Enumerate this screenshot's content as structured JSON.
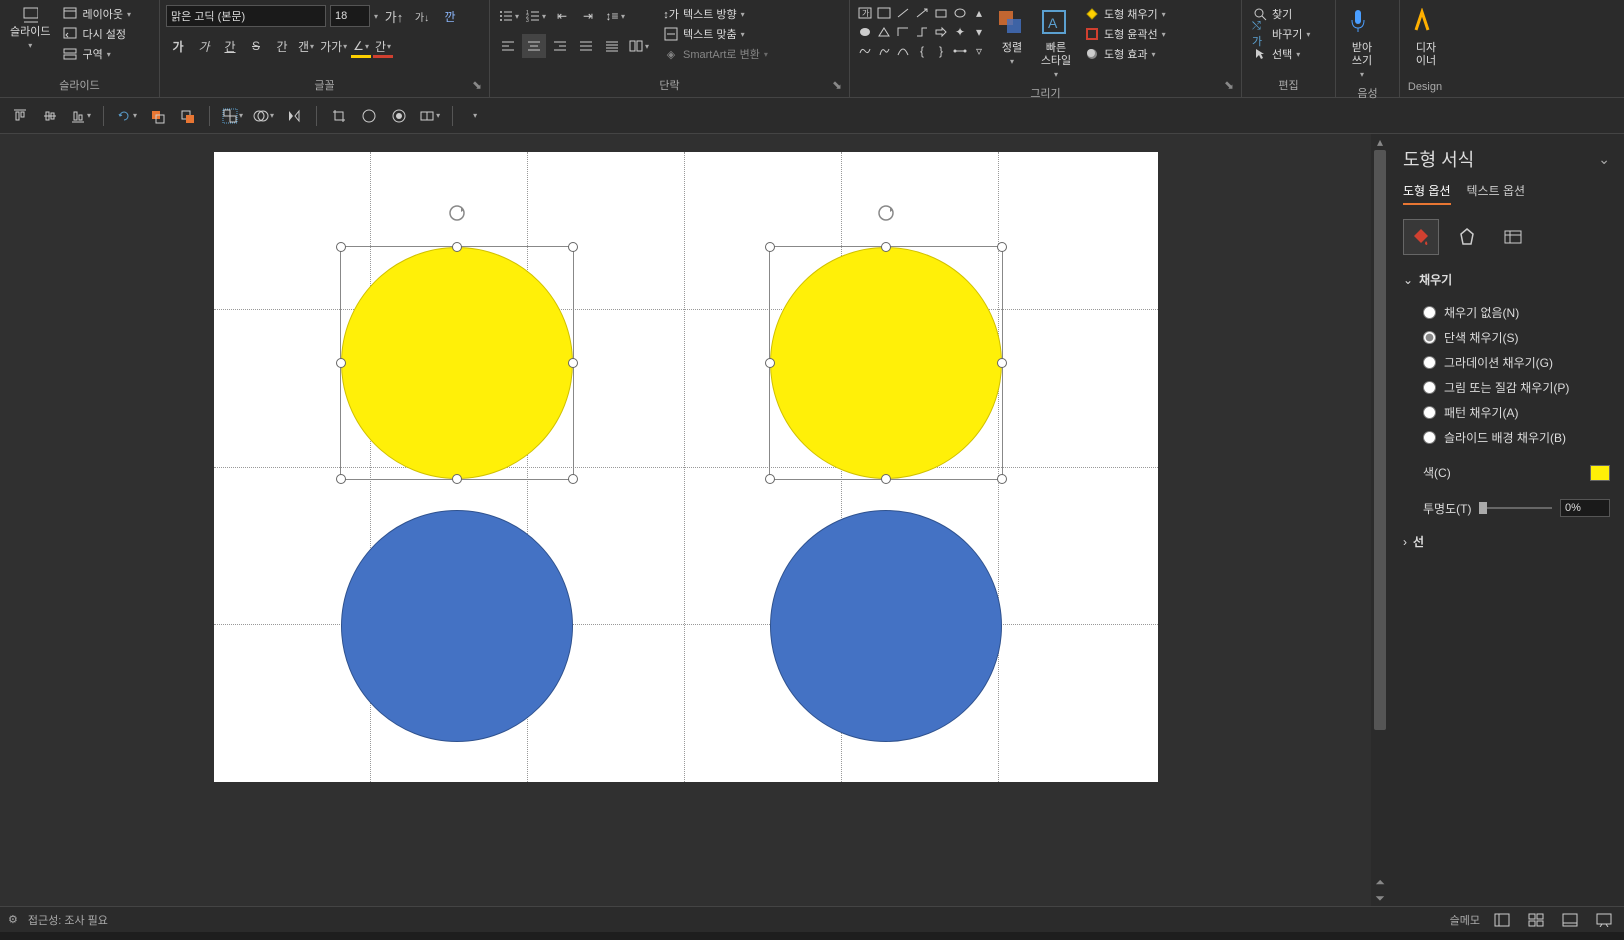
{
  "ribbon": {
    "slide_group": {
      "new_slide": "슬라이드",
      "layout": "레이아웃",
      "reset": "다시 설정",
      "section": "구역",
      "label": "슬라이드"
    },
    "font_group": {
      "font_name": "맑은 고딕 (본문)",
      "font_size": "18",
      "label": "글꼴"
    },
    "paragraph_group": {
      "text_direction": "텍스트 방향",
      "align_text": "텍스트 맞춤",
      "smartart": "SmartArt로 변환",
      "label": "단락"
    },
    "drawing_group": {
      "arrange": "정렬",
      "quick_styles": "빠른\n스타일",
      "shape_fill": "도형 채우기",
      "shape_outline": "도형 윤곽선",
      "shape_effects": "도형 효과",
      "label": "그리기"
    },
    "editing_group": {
      "find": "찾기",
      "replace": "바꾸기",
      "select": "선택",
      "label": "편집"
    },
    "voice_group": {
      "dictate": "받아\n쓰기",
      "label": "음성"
    },
    "design_group": {
      "designer": "디자\n이너",
      "label": "Design"
    }
  },
  "format_pane": {
    "title": "도형 서식",
    "tab_shape": "도형 옵션",
    "tab_text": "텍스트 옵션",
    "section_fill": "채우기",
    "fill_none": "채우기 없음(N)",
    "fill_solid": "단색 채우기(S)",
    "fill_gradient": "그라데이션 채우기(G)",
    "fill_picture": "그림 또는 질감 채우기(P)",
    "fill_pattern": "패턴 채우기(A)",
    "fill_slidebg": "슬라이드 배경 채우기(B)",
    "color_label": "색(C)",
    "transparency_label": "투명도(T)",
    "transparency_value": "0%",
    "section_line": "선"
  },
  "statusbar": {
    "accessibility": "접근성: 조사 필요",
    "memo": "슬메모"
  }
}
